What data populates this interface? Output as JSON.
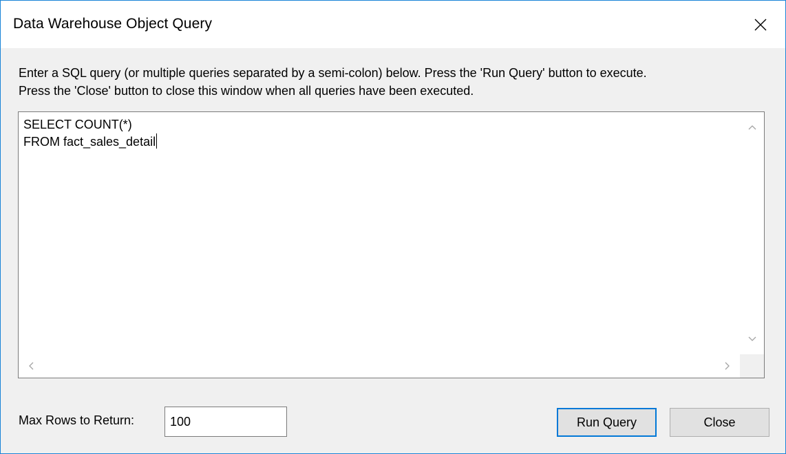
{
  "window": {
    "title": "Data Warehouse Object Query"
  },
  "instructions": {
    "line1": "Enter a SQL query (or multiple queries separated by a semi-colon) below. Press the 'Run Query' button to execute.",
    "line2": "Press the 'Close' button to close this window when all queries have been executed."
  },
  "editor": {
    "line1": "SELECT COUNT(*)",
    "line2": "FROM fact_sales_detail"
  },
  "max_rows": {
    "label": "Max Rows to Return:",
    "value": "100"
  },
  "buttons": {
    "run_query": "Run Query",
    "close": "Close"
  },
  "icons": {
    "title_close": "close-icon",
    "scroll_up": "chevron-up-icon",
    "scroll_down": "chevron-down-icon",
    "scroll_left": "chevron-left-icon",
    "scroll_right": "chevron-right-icon"
  },
  "colors": {
    "window_border": "#1883d7",
    "default_button_border": "#0078d7",
    "dialog_background": "#f0f0f0"
  }
}
